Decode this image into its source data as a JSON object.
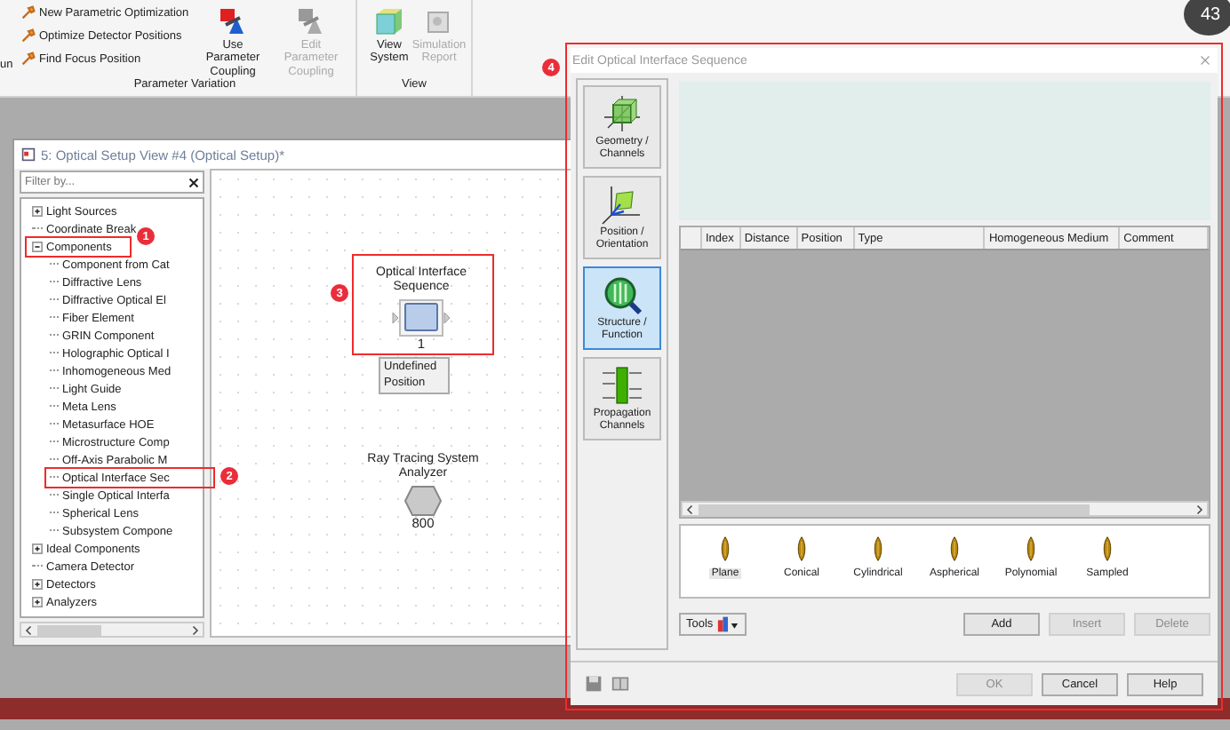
{
  "ribbon": {
    "cut_label": "un",
    "small_commands": [
      {
        "label": "New Parametric Optimization"
      },
      {
        "label": "Optimize Detector Positions"
      },
      {
        "label": "Find Focus Position"
      }
    ],
    "groups": [
      {
        "label": "Parameter Variation",
        "buttons": [
          {
            "kind": "coupling",
            "label": "Use Parameter Coupling",
            "disabled": false
          },
          {
            "kind": "edit-coupling",
            "label": "Edit Parameter Coupling",
            "disabled": true
          }
        ]
      },
      {
        "label": "View",
        "buttons": [
          {
            "kind": "view3d",
            "label": "View System",
            "disabled": false
          },
          {
            "kind": "report",
            "label": "Simulation Report",
            "disabled": true
          }
        ]
      }
    ]
  },
  "corner_badge": "43",
  "setup_window": {
    "title": "5: Optical Setup View #4 (Optical Setup)*",
    "filter": {
      "placeholder": "Filter by..."
    },
    "tree": [
      {
        "kind": "group",
        "label": "Light Sources",
        "expanded": false
      },
      {
        "kind": "leaf",
        "label": "Coordinate Break"
      },
      {
        "kind": "group",
        "label": "Components",
        "expanded": true,
        "children": [
          {
            "label": "Component from Cat"
          },
          {
            "label": "Diffractive Lens"
          },
          {
            "label": "Diffractive Optical El"
          },
          {
            "label": "Fiber Element"
          },
          {
            "label": "GRIN Component"
          },
          {
            "label": "Holographic Optical I"
          },
          {
            "label": "Inhomogeneous Med"
          },
          {
            "label": "Light Guide"
          },
          {
            "label": "Meta Lens"
          },
          {
            "label": "Metasurface HOE"
          },
          {
            "label": "Microstructure Comp"
          },
          {
            "label": "Off-Axis Parabolic M"
          },
          {
            "label": "Optical Interface Sec"
          },
          {
            "label": "Single Optical Interfa"
          },
          {
            "label": "Spherical Lens"
          },
          {
            "label": "Subsystem Compone"
          }
        ]
      },
      {
        "kind": "group",
        "label": "Ideal Components",
        "expanded": false
      },
      {
        "kind": "leaf",
        "label": "Camera Detector"
      },
      {
        "kind": "group",
        "label": "Detectors",
        "expanded": false
      },
      {
        "kind": "group",
        "label": "Analyzers",
        "expanded": false
      }
    ],
    "nodes": [
      {
        "kind": "component",
        "label": "Optical Interface Sequence",
        "number": "1",
        "tooltip": "Undefined Position"
      },
      {
        "kind": "analyzer",
        "label": "Ray Tracing System Analyzer",
        "number": "800"
      }
    ]
  },
  "dialog": {
    "title": "Edit Optical Interface Sequence",
    "nav": [
      {
        "kind": "geometry",
        "label": "Geometry / Channels",
        "selected": false
      },
      {
        "kind": "position",
        "label": "Position / Orientation",
        "selected": false
      },
      {
        "kind": "structure",
        "label": "Structure / Function",
        "selected": true
      },
      {
        "kind": "propagation",
        "label": "Propagation Channels",
        "selected": false
      }
    ],
    "table": {
      "columns": [
        "Index",
        "Distance",
        "Position",
        "Type",
        "Homogeneous Medium",
        "Comment"
      ]
    },
    "surfaces": [
      {
        "label": "Plane",
        "selected": true
      },
      {
        "label": "Conical",
        "selected": false
      },
      {
        "label": "Cylindrical",
        "selected": false
      },
      {
        "label": "Aspherical",
        "selected": false
      },
      {
        "label": "Polynomial",
        "selected": false
      },
      {
        "label": "Sampled",
        "selected": false
      }
    ],
    "tools_button": "Tools",
    "actions": [
      {
        "label": "Add",
        "disabled": false
      },
      {
        "label": "Insert",
        "disabled": true
      },
      {
        "label": "Delete",
        "disabled": true
      }
    ],
    "footer_buttons": [
      {
        "label": "OK",
        "disabled": true
      },
      {
        "label": "Cancel",
        "disabled": false
      },
      {
        "label": "Help",
        "disabled": false
      }
    ]
  },
  "annotations": [
    {
      "number": "1"
    },
    {
      "number": "2"
    },
    {
      "number": "3"
    },
    {
      "number": "4"
    }
  ]
}
